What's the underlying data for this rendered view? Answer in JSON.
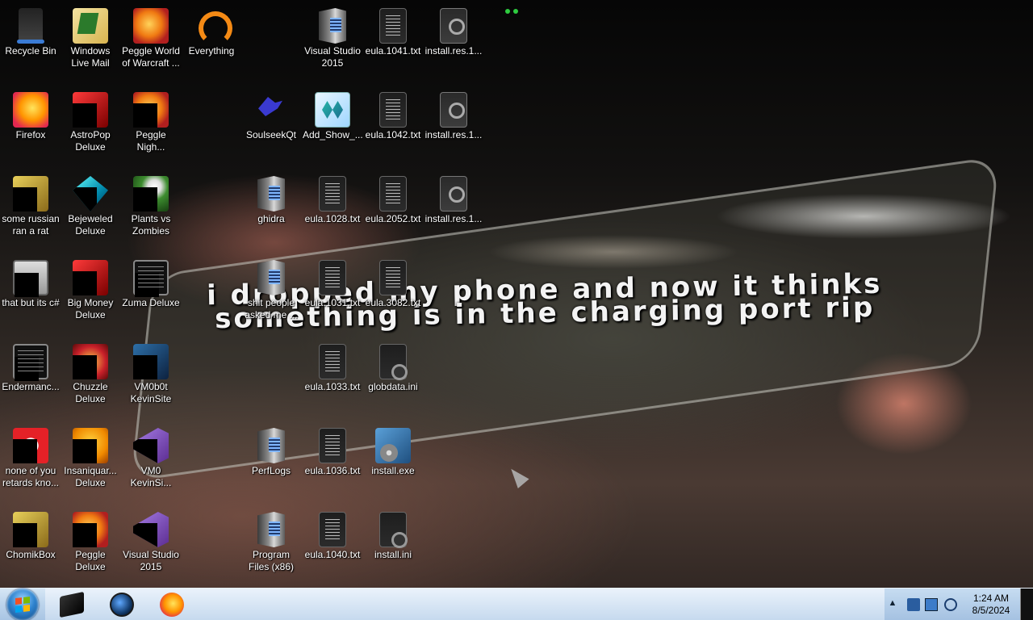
{
  "wallpaper": {
    "caption_line1": "i dropped my phone and now it thinks",
    "caption_line2": "something is in the charging port rip"
  },
  "desktop_icons": [
    {
      "label": "Recycle Bin",
      "icon": "recycle-bin-icon"
    },
    {
      "label": "Windows Live Mail",
      "icon": "mail-icon"
    },
    {
      "label": "Peggle World of Warcraft ...",
      "icon": "peggle-icon"
    },
    {
      "label": "Everything",
      "icon": "everything-icon"
    },
    {
      "label": "Visual Studio 2015",
      "icon": "folder-icon"
    },
    {
      "label": "eula.1041.txt",
      "icon": "text-file-icon"
    },
    {
      "label": "install.res.1...",
      "icon": "resource-file-icon"
    },
    {
      "label": "Firefox",
      "icon": "firefox-icon"
    },
    {
      "label": "AstroPop Deluxe",
      "icon": "astropop-icon"
    },
    {
      "label": "Peggle Nigh...",
      "icon": "peggle-icon"
    },
    {
      "label": "SoulseekQt",
      "icon": "soulseek-icon"
    },
    {
      "label": "Add_Show_...",
      "icon": "registry-file-icon"
    },
    {
      "label": "eula.1042.txt",
      "icon": "text-file-icon"
    },
    {
      "label": "install.res.1...",
      "icon": "resource-file-icon"
    },
    {
      "label": "some russian ran a rat",
      "icon": "java-icon"
    },
    {
      "label": "Bejeweled Deluxe",
      "icon": "gem-icon"
    },
    {
      "label": "Plants vs Zombies",
      "icon": "plant-icon"
    },
    {
      "label": "ghidra",
      "icon": "folder-icon"
    },
    {
      "label": "eula.1028.txt",
      "icon": "text-file-icon"
    },
    {
      "label": "eula.2052.txt",
      "icon": "text-file-icon"
    },
    {
      "label": "install.res.1...",
      "icon": "resource-file-icon"
    },
    {
      "label": "that but its c#",
      "icon": "stack-icon"
    },
    {
      "label": "Big Money Deluxe",
      "icon": "money-icon"
    },
    {
      "label": "Zuma Deluxe",
      "icon": "terminal-icon"
    },
    {
      "label": "shit people asked me ...",
      "icon": "folder-icon"
    },
    {
      "label": "eula.1031.txt",
      "icon": "text-file-icon"
    },
    {
      "label": "eula.3082.txt",
      "icon": "text-file-icon"
    },
    {
      "label": "Endermanc...",
      "icon": "terminal-icon"
    },
    {
      "label": "Chuzzle Deluxe",
      "icon": "chuzzle-icon"
    },
    {
      "label": "VM0b0t KevinSite",
      "icon": "vm-icon"
    },
    {
      "label": "eula.1033.txt",
      "icon": "text-file-icon"
    },
    {
      "label": "globdata.ini",
      "icon": "ini-file-icon"
    },
    {
      "label": "none of you retards kno...",
      "icon": "opera-icon"
    },
    {
      "label": "Insaniquar... Deluxe",
      "icon": "insaniquarium-icon"
    },
    {
      "label": "VM0 KevinSi...",
      "icon": "vm-icon"
    },
    {
      "label": "PerfLogs",
      "icon": "folder-icon"
    },
    {
      "label": "eula.1036.txt",
      "icon": "text-file-icon"
    },
    {
      "label": "install.exe",
      "icon": "installer-icon"
    },
    {
      "label": "ChomikBox",
      "icon": "chomikbox-icon"
    },
    {
      "label": "Peggle Deluxe",
      "icon": "peggle-icon"
    },
    {
      "label": "Visual Studio 2015",
      "icon": "visual-studio-icon"
    },
    {
      "label": "Program Files (x86)",
      "icon": "folder-icon"
    },
    {
      "label": "eula.1040.txt",
      "icon": "text-file-icon"
    },
    {
      "label": "install.ini",
      "icon": "ini-file-icon"
    }
  ],
  "taskbar": {
    "start_label": "Start",
    "pinned": [
      {
        "name": "app-box-icon"
      },
      {
        "name": "globe-icon"
      },
      {
        "name": "firefox-icon"
      }
    ],
    "tray_arrow": "▲",
    "clock_time": "1:24 AM",
    "clock_date": "8/5/2024"
  },
  "colors": {
    "taskbar": "#bcd4ec",
    "tray": "#a4c1e1",
    "text_shadow": "#000000"
  }
}
